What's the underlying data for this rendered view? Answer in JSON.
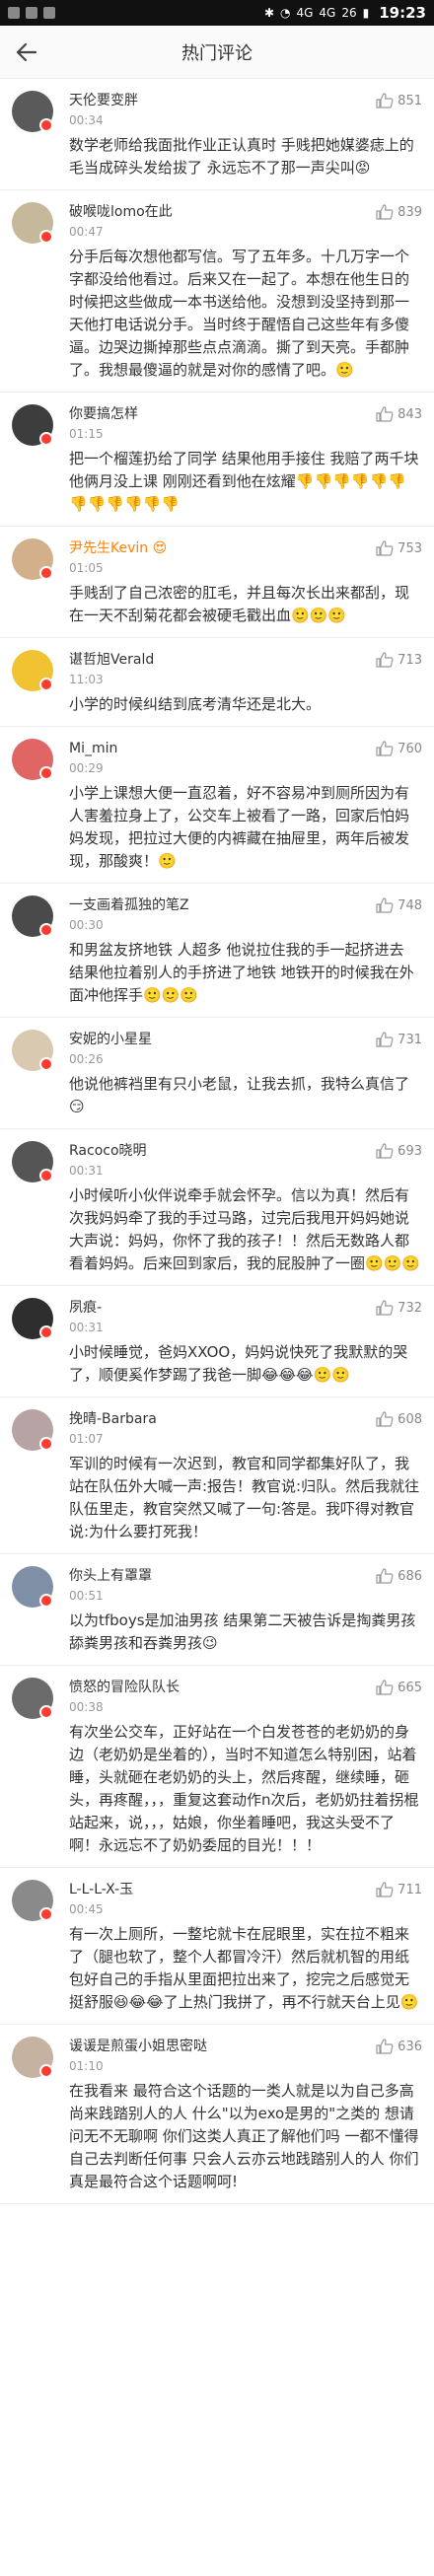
{
  "status_bar": {
    "network": "4G",
    "network2": "4G",
    "battery": "26",
    "time": "19:23"
  },
  "header": {
    "title": "热门评论"
  },
  "comments": [
    {
      "name": "天伦要变胖",
      "time": "00:34",
      "likes": "851",
      "text": "数学老师给我面批作业正认真时 手贱把她媒婆痣上的毛当成碎头发给拔了 永远忘不了那一声尖叫😡",
      "avatar_color": "#5a5a5a"
    },
    {
      "name": "破喉咙lomo在此",
      "time": "00:47",
      "likes": "839",
      "text": "分手后每次想他都写信。写了五年多。十几万字一个字都没给他看过。后来又在一起了。本想在他生日的时候把这些做成一本书送给他。没想到没坚持到那一天他打电话说分手。当时终于醒悟自己这些年有多傻逼。边哭边撕掉那些点点滴滴。撕了到天亮。手都肿了。我想最傻逼的就是对你的感情了吧。🙂",
      "avatar_color": "#c6b89a"
    },
    {
      "name": "你要搞怎样",
      "time": "01:15",
      "likes": "843",
      "text": "把一个榴莲扔给了同学 结果他用手接住 我赔了两千块 他俩月没上课 刚刚还看到他在炫耀👎👎👎👎👎👎👎👎👎👎👎👎",
      "avatar_color": "#3d3d3d"
    },
    {
      "name": "尹先生Kevin 😍",
      "time": "01:05",
      "likes": "753",
      "text": "手贱刮了自己浓密的肛毛，并且每次长出来都刮，现在一天不刮菊花都会被硬毛戳出血🙂🙂🙂",
      "avatar_color": "#d3b08c"
    },
    {
      "name": "谌哲旭Verald",
      "time": "11:03",
      "likes": "713",
      "text": "小学的时候纠结到底考清华还是北大。",
      "avatar_color": "#f1c232"
    },
    {
      "name": "Mi_min",
      "time": "00:29",
      "likes": "760",
      "text": "小学上课想大便一直忍着，好不容易冲到厕所因为有人害羞拉身上了，公交车上被看了一路，回家后怕妈妈发现，把拉过大便的内裤藏在抽屉里，两年后被发现，那酸爽！🙂",
      "avatar_color": "#e06666"
    },
    {
      "name": "一支画着孤独的笔Z",
      "time": "00:30",
      "likes": "748",
      "text": "和男盆友挤地铁 人超多 他说拉住我的手一起挤进去 结果他拉着别人的手挤进了地铁 地铁开的时候我在外面冲他挥手🙂🙂🙂",
      "avatar_color": "#4a4a4a"
    },
    {
      "name": "安妮的小星星",
      "time": "00:26",
      "likes": "731",
      "text": "他说他裤裆里有只小老鼠，让我去抓，我特么真信了😏",
      "avatar_color": "#d9c9b0"
    },
    {
      "name": "Racoco晓明",
      "time": "00:31",
      "likes": "693",
      "text": "小时候听小伙伴说牵手就会怀孕。信以为真！然后有次我妈妈牵了我的手过马路，过完后我甩开妈妈她说大声说：妈妈，你怀了我的孩子！！然后无数路人都看着妈妈。后来回到家后，我的屁股肿了一圈🙂🙂🙂",
      "avatar_color": "#555555"
    },
    {
      "name": "夙痕-",
      "time": "00:31",
      "likes": "732",
      "text": "小时候睡觉，爸妈XXOO，妈妈说快死了我默默的哭了，顺便奚作梦踢了我爸一脚😂😂😂🙂🙂",
      "avatar_color": "#2e2e2e"
    },
    {
      "name": "挽晴-Barbara",
      "time": "01:07",
      "likes": "608",
      "text": "军训的时候有一次迟到，教官和同学都集好队了，我站在队伍外大喊一声:报告！教官说:归队。然后我就往队伍里走，教官突然又喊了一句:答是。我吓得对教官说:为什么要打死我！",
      "avatar_color": "#b7a3a3"
    },
    {
      "name": "你头上有罩罩",
      "time": "00:51",
      "likes": "686",
      "text": "以为tfboys是加油男孩 结果第二天被告诉是掏粪男孩舔粪男孩和吞粪男孩😉",
      "avatar_color": "#7f8fa6"
    },
    {
      "name": "愤怒的冒险队队长",
      "time": "00:38",
      "likes": "665",
      "text": "有次坐公交车，正好站在一个白发苍苍的老奶奶的身边（老奶奶是坐着的），当时不知道怎么特别困，站着睡，头就砸在老奶奶的头上，然后疼醒，继续睡，砸头，再疼醒，，，重复这套动作n次后，老奶奶拄着拐棍站起来，说，，，姑娘，你坐着睡吧，我这头受不了啊！永远忘不了奶奶委屈的目光！！！",
      "avatar_color": "#6b6b6b"
    },
    {
      "name": "L-L-L-X-玉",
      "time": "00:45",
      "likes": "711",
      "text": "有一次上厕所，一整坨就卡在屁眼里，实在拉不粗来了（腿也软了，整个人都冒冷汗）然后就机智的用纸包好自己的手指从里面把拉出来了，挖完之后感觉无挺舒服😆😂😂了上热门我拼了，再不行就天台上见🙂",
      "avatar_color": "#8a8a8a"
    },
    {
      "name": "谖谖是煎蛋小姐思密哒",
      "time": "01:10",
      "likes": "636",
      "text": "在我看来 最符合这个话题的一类人就是以为自己多高尚来践踏别人的人 什么\"以为exo是男的\"之类的 想请问无不无聊啊 你们这类人真正了解他们吗 一都不懂得自己去判断任何事 只会人云亦云地践踏别人的人 你们真是最符合这个话题啊呵!",
      "avatar_color": "#c5b2a0"
    }
  ]
}
